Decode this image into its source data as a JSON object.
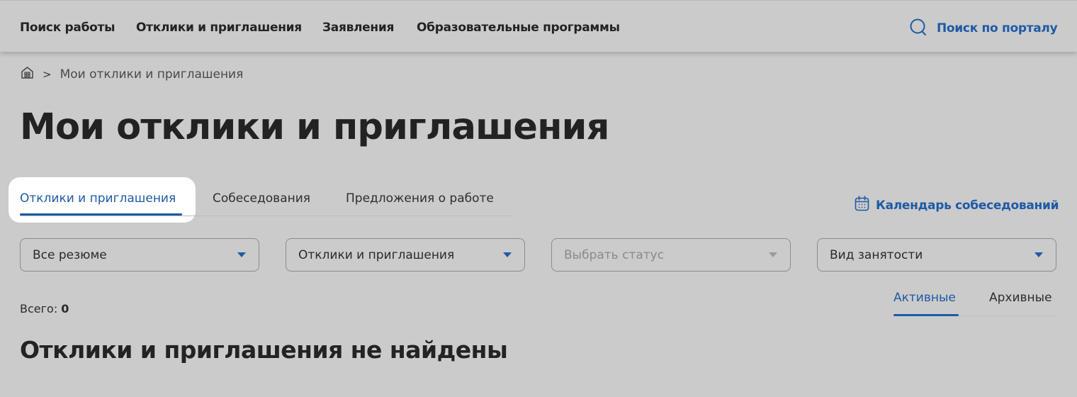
{
  "nav": {
    "items": [
      {
        "label": "Поиск работы"
      },
      {
        "label": "Отклики и приглашения"
      },
      {
        "label": "Заявления"
      },
      {
        "label": "Образовательные программы"
      }
    ],
    "portal_search_label": "Поиск по порталу"
  },
  "breadcrumb": {
    "home_icon": "home-icon",
    "separator": ">",
    "current": "Мои отклики и приглашения"
  },
  "page_title": "Мои отклики и приглашения",
  "tabs": [
    {
      "label": "Отклики и приглашения",
      "active": true
    },
    {
      "label": "Собеседования",
      "active": false
    },
    {
      "label": "Предложения о работе",
      "active": false
    }
  ],
  "calendar_link": "Календарь собеседований",
  "filters": [
    {
      "value": "Все резюме",
      "disabled": false
    },
    {
      "value": "Отклики и приглашения",
      "disabled": false
    },
    {
      "value": "Выбрать статус",
      "disabled": true
    },
    {
      "value": "Вид занятости",
      "disabled": false
    }
  ],
  "total": {
    "label": "Всего:",
    "count": "0"
  },
  "subtabs": [
    {
      "label": "Активные",
      "active": true
    },
    {
      "label": "Архивные",
      "active": false
    }
  ],
  "empty_message": "Отклики и приглашения не найдены",
  "colors": {
    "accent": "#1f5aa6",
    "background": "#cbcbcb",
    "text": "#232323"
  }
}
